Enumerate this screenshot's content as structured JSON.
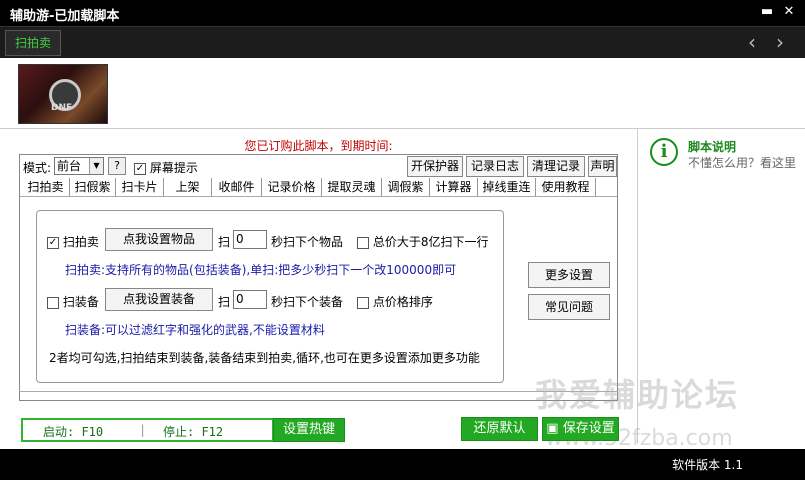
{
  "window": {
    "title": "辅助游-已加载脚本",
    "minimize": "▬",
    "close": "✕"
  },
  "tabbar": {
    "active_tab": "扫拍卖",
    "prev": "‹",
    "next": "›"
  },
  "logo": {
    "text": "DNF"
  },
  "subscription": "您已订购此脚本，到期时间:",
  "toolbar": {
    "mode_label": "模式:",
    "mode_value": "前台",
    "help_q": "?",
    "screen_hint": "屏幕提示",
    "screen_hint_checked": "✓",
    "btn_protect": "开保护器",
    "btn_log": "记录日志",
    "btn_clear": "清理记录",
    "btn_statement": "声明"
  },
  "tabs": [
    "扫拍卖",
    "扫假紫",
    "扫卡片",
    "上架",
    "收邮件",
    "记录价格",
    "提取灵魂",
    "调假紫",
    "计算器",
    "掉线重连",
    "使用教程"
  ],
  "auction": {
    "checkbox_checked": "✓",
    "label": "扫拍卖",
    "set_button": "点我设置物品",
    "scan_label": "扫",
    "seconds_value": "0",
    "seconds_suffix": "秒扫下个物品",
    "total_label": "总价大于8亿扫下一行",
    "desc": "扫拍卖:支持所有的物品(包括装备),单扫:把多少秒扫下一个改100000即可"
  },
  "equip": {
    "label": "扫装备",
    "set_button": "点我设置装备",
    "scan_label": "扫",
    "seconds_value": "0",
    "seconds_suffix": "秒扫下个装备",
    "sort_label": "点价格排序",
    "desc": "扫装备:可以过滤红字和强化的武器,不能设置材料"
  },
  "note": "2者均可勾选,扫拍结束到装备,装备结束到拍卖,循环,也可在更多设置添加更多功能",
  "side_buttons": {
    "more": "更多设置",
    "faq": "常见问题"
  },
  "help": {
    "title": "脚本说明",
    "subtitle": "不懂怎么用？看这里"
  },
  "hotkeys": {
    "start": "启动: F10",
    "sep": "|",
    "stop": "停止: F12"
  },
  "buttons": {
    "set_hotkey": "设置热键",
    "restore": "还原默认",
    "save": "保存设置",
    "save_icon": "▣"
  },
  "watermark": {
    "line1": "我爱辅助论坛",
    "line2": "www.52fzba.com"
  },
  "footer": {
    "version": "软件版本 1.1"
  }
}
